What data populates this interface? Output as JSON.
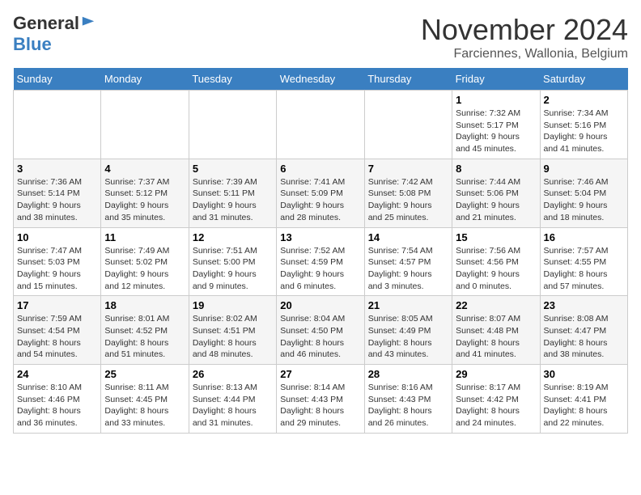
{
  "header": {
    "logo_general": "General",
    "logo_blue": "Blue",
    "month_title": "November 2024",
    "subtitle": "Farciennes, Wallonia, Belgium"
  },
  "days_of_week": [
    "Sunday",
    "Monday",
    "Tuesday",
    "Wednesday",
    "Thursday",
    "Friday",
    "Saturday"
  ],
  "weeks": [
    [
      {
        "day": "",
        "info": ""
      },
      {
        "day": "",
        "info": ""
      },
      {
        "day": "",
        "info": ""
      },
      {
        "day": "",
        "info": ""
      },
      {
        "day": "",
        "info": ""
      },
      {
        "day": "1",
        "info": "Sunrise: 7:32 AM\nSunset: 5:17 PM\nDaylight: 9 hours\nand 45 minutes."
      },
      {
        "day": "2",
        "info": "Sunrise: 7:34 AM\nSunset: 5:16 PM\nDaylight: 9 hours\nand 41 minutes."
      }
    ],
    [
      {
        "day": "3",
        "info": "Sunrise: 7:36 AM\nSunset: 5:14 PM\nDaylight: 9 hours\nand 38 minutes."
      },
      {
        "day": "4",
        "info": "Sunrise: 7:37 AM\nSunset: 5:12 PM\nDaylight: 9 hours\nand 35 minutes."
      },
      {
        "day": "5",
        "info": "Sunrise: 7:39 AM\nSunset: 5:11 PM\nDaylight: 9 hours\nand 31 minutes."
      },
      {
        "day": "6",
        "info": "Sunrise: 7:41 AM\nSunset: 5:09 PM\nDaylight: 9 hours\nand 28 minutes."
      },
      {
        "day": "7",
        "info": "Sunrise: 7:42 AM\nSunset: 5:08 PM\nDaylight: 9 hours\nand 25 minutes."
      },
      {
        "day": "8",
        "info": "Sunrise: 7:44 AM\nSunset: 5:06 PM\nDaylight: 9 hours\nand 21 minutes."
      },
      {
        "day": "9",
        "info": "Sunrise: 7:46 AM\nSunset: 5:04 PM\nDaylight: 9 hours\nand 18 minutes."
      }
    ],
    [
      {
        "day": "10",
        "info": "Sunrise: 7:47 AM\nSunset: 5:03 PM\nDaylight: 9 hours\nand 15 minutes."
      },
      {
        "day": "11",
        "info": "Sunrise: 7:49 AM\nSunset: 5:02 PM\nDaylight: 9 hours\nand 12 minutes."
      },
      {
        "day": "12",
        "info": "Sunrise: 7:51 AM\nSunset: 5:00 PM\nDaylight: 9 hours\nand 9 minutes."
      },
      {
        "day": "13",
        "info": "Sunrise: 7:52 AM\nSunset: 4:59 PM\nDaylight: 9 hours\nand 6 minutes."
      },
      {
        "day": "14",
        "info": "Sunrise: 7:54 AM\nSunset: 4:57 PM\nDaylight: 9 hours\nand 3 minutes."
      },
      {
        "day": "15",
        "info": "Sunrise: 7:56 AM\nSunset: 4:56 PM\nDaylight: 9 hours\nand 0 minutes."
      },
      {
        "day": "16",
        "info": "Sunrise: 7:57 AM\nSunset: 4:55 PM\nDaylight: 8 hours\nand 57 minutes."
      }
    ],
    [
      {
        "day": "17",
        "info": "Sunrise: 7:59 AM\nSunset: 4:54 PM\nDaylight: 8 hours\nand 54 minutes."
      },
      {
        "day": "18",
        "info": "Sunrise: 8:01 AM\nSunset: 4:52 PM\nDaylight: 8 hours\nand 51 minutes."
      },
      {
        "day": "19",
        "info": "Sunrise: 8:02 AM\nSunset: 4:51 PM\nDaylight: 8 hours\nand 48 minutes."
      },
      {
        "day": "20",
        "info": "Sunrise: 8:04 AM\nSunset: 4:50 PM\nDaylight: 8 hours\nand 46 minutes."
      },
      {
        "day": "21",
        "info": "Sunrise: 8:05 AM\nSunset: 4:49 PM\nDaylight: 8 hours\nand 43 minutes."
      },
      {
        "day": "22",
        "info": "Sunrise: 8:07 AM\nSunset: 4:48 PM\nDaylight: 8 hours\nand 41 minutes."
      },
      {
        "day": "23",
        "info": "Sunrise: 8:08 AM\nSunset: 4:47 PM\nDaylight: 8 hours\nand 38 minutes."
      }
    ],
    [
      {
        "day": "24",
        "info": "Sunrise: 8:10 AM\nSunset: 4:46 PM\nDaylight: 8 hours\nand 36 minutes."
      },
      {
        "day": "25",
        "info": "Sunrise: 8:11 AM\nSunset: 4:45 PM\nDaylight: 8 hours\nand 33 minutes."
      },
      {
        "day": "26",
        "info": "Sunrise: 8:13 AM\nSunset: 4:44 PM\nDaylight: 8 hours\nand 31 minutes."
      },
      {
        "day": "27",
        "info": "Sunrise: 8:14 AM\nSunset: 4:43 PM\nDaylight: 8 hours\nand 29 minutes."
      },
      {
        "day": "28",
        "info": "Sunrise: 8:16 AM\nSunset: 4:43 PM\nDaylight: 8 hours\nand 26 minutes."
      },
      {
        "day": "29",
        "info": "Sunrise: 8:17 AM\nSunset: 4:42 PM\nDaylight: 8 hours\nand 24 minutes."
      },
      {
        "day": "30",
        "info": "Sunrise: 8:19 AM\nSunset: 4:41 PM\nDaylight: 8 hours\nand 22 minutes."
      }
    ]
  ]
}
